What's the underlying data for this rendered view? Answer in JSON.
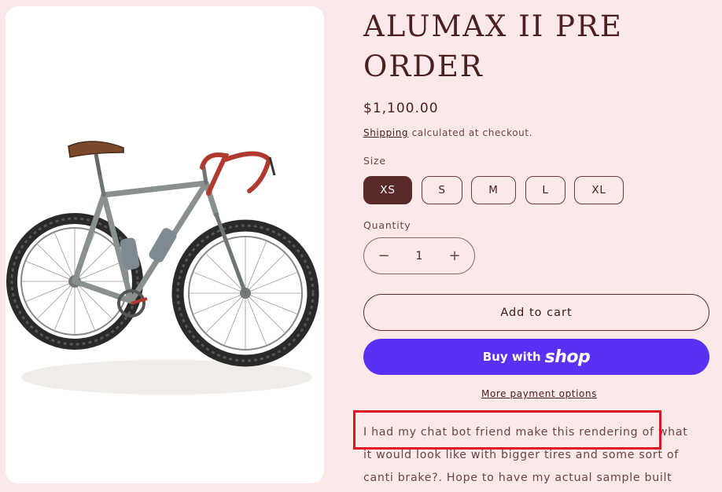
{
  "product": {
    "title": "ALUMAX II PRE ORDER",
    "price": "$1,100.00",
    "shipping_link": "Shipping",
    "shipping_suffix": " calculated at checkout.",
    "image_alt": "Illustration of a gravel bicycle with wide knobby tires"
  },
  "size": {
    "label": "Size",
    "selected": "XS",
    "options": [
      "XS",
      "S",
      "M",
      "L",
      "XL"
    ]
  },
  "quantity": {
    "label": "Quantity",
    "value": "1",
    "decrease_symbol": "−",
    "increase_symbol": "+"
  },
  "buttons": {
    "add_to_cart": "Add to cart",
    "buy_with": "Buy with",
    "shop_logo": "shop",
    "more_payment": "More payment options"
  },
  "description": {
    "lines": [
      "I had my chat bot friend make this rendering of what",
      "it would look like with bigger tires and some sort of",
      "canti brake?.  Hope to have my actual sample built"
    ]
  },
  "colors": {
    "background": "#fbe8e8",
    "accent": "#5a2a2a",
    "shop_purple": "#5a31f4",
    "highlight": "#e0141e"
  }
}
